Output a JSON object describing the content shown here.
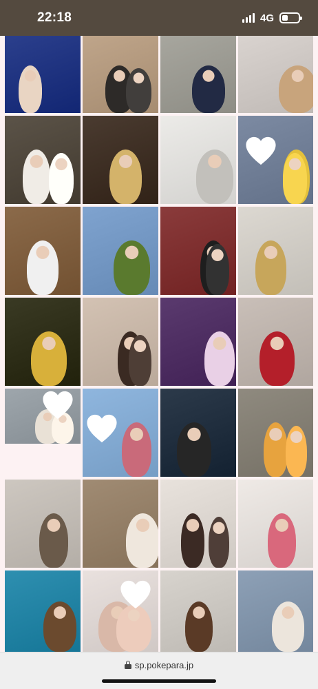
{
  "status_bar": {
    "time": "22:18",
    "network": "4G",
    "battery_level": 0.35
  },
  "browser": {
    "url": "sp.pokepara.jp"
  },
  "gallery": {
    "photos": [
      {
        "alt": "",
        "bg": "#2b3f8c",
        "accent": "#e9d5c3"
      },
      {
        "alt": "",
        "bg": "#bfa58a",
        "accent": "#2d2a28"
      },
      {
        "alt": "",
        "bg": "#a7a69e",
        "accent": "#222a44"
      },
      {
        "alt": "",
        "bg": "#d9d3cf",
        "accent": "#c8a47c"
      },
      {
        "alt": "",
        "bg": "#5b5348",
        "accent": "#f0ece6"
      },
      {
        "alt": "",
        "bg": "#4a3b30",
        "accent": "#d4b36a"
      },
      {
        "alt": "",
        "bg": "#ecebe8",
        "accent": "#c2c0bb"
      },
      {
        "alt": "",
        "bg": "#7c8aa2",
        "accent": "#e4c13b"
      },
      {
        "alt": "",
        "bg": "#8b6a4a",
        "accent": "#f0f0f0"
      },
      {
        "alt": "",
        "bg": "#7fa3cf",
        "accent": "#5a7a2e"
      },
      {
        "alt": "",
        "bg": "#8a3b3b",
        "accent": "#1e1e1e"
      },
      {
        "alt": "",
        "bg": "#dcd8d1",
        "accent": "#c7a65b"
      },
      {
        "alt": "",
        "bg": "#3a3a24",
        "accent": "#d8b03a"
      },
      {
        "alt": "",
        "bg": "#d3c2b3",
        "accent": "#3a2a22"
      },
      {
        "alt": "",
        "bg": "#5a3a6e",
        "accent": "#e9d0e6"
      },
      {
        "alt": "",
        "bg": "#c9bfb8",
        "accent": "#b41f2a"
      },
      {
        "alt": "",
        "bg": "#9ea6ac",
        "accent": "#e9e1d6"
      },
      {
        "alt": "",
        "bg": "#8fb6de",
        "accent": "#c96a7a"
      },
      {
        "alt": "",
        "bg": "#2c3a4a",
        "accent": "#262626"
      },
      {
        "alt": "",
        "bg": "#8f8a7f",
        "accent": "#e7a33e"
      },
      {
        "alt": "",
        "bg": "#cdc7c0",
        "accent": "#6a5a4a"
      },
      {
        "alt": "",
        "bg": "#a08b73",
        "accent": "#efe7dd"
      },
      {
        "alt": "",
        "bg": "#e8e2dc",
        "accent": "#3b2a24"
      },
      {
        "alt": "",
        "bg": "#efeae6",
        "accent": "#d9687c"
      },
      {
        "alt": "",
        "bg": "#2e8fb0",
        "accent": "#6b4a2e"
      },
      {
        "alt": "",
        "bg": "#e9e1de",
        "accent": "#d9b8a8"
      },
      {
        "alt": "",
        "bg": "#d7d3cd",
        "accent": "#5a3a26"
      },
      {
        "alt": "",
        "bg": "#8da0b6",
        "accent": "#ece5dc"
      }
    ]
  }
}
